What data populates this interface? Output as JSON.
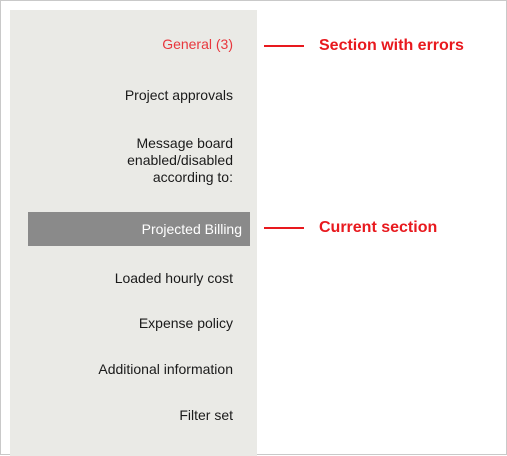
{
  "nav": {
    "items": [
      {
        "label": "General (3)"
      },
      {
        "label": "Project approvals"
      },
      {
        "label": "Message board enabled/disabled according to:",
        "lines": [
          "Message board",
          "enabled/disabled",
          "according to:"
        ]
      },
      {
        "label": "Projected Billing"
      },
      {
        "label": "Loaded hourly cost"
      },
      {
        "label": "Expense policy"
      },
      {
        "label": "Additional information"
      },
      {
        "label": "Filter set"
      }
    ]
  },
  "annotations": {
    "errors": "Section with errors",
    "current": "Current section"
  },
  "colors": {
    "sidebar_bg": "#eaeae6",
    "error_text": "#e8373d",
    "current_bg": "#8a8a8a",
    "annotation": "#e8191e"
  }
}
